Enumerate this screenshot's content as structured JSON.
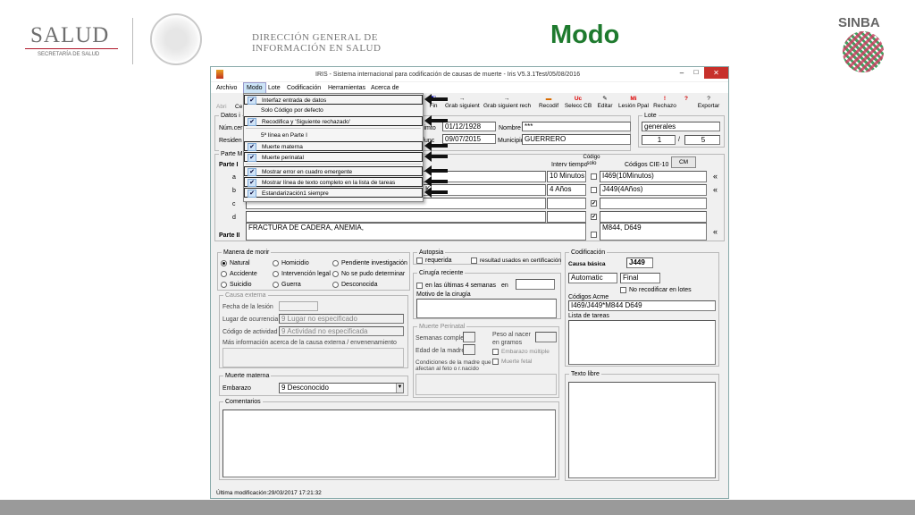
{
  "slide": {
    "title": "Modo",
    "header": {
      "salud": "SALUD",
      "secretaria": "SECRETARÍA DE SALUD",
      "direccion_l1": "DIRECCIÓN GENERAL DE",
      "direccion_l2": "INFORMACIÓN EN SALUD",
      "sinba": "SINBA"
    }
  },
  "window": {
    "title": "IRIS - Sistema internacional para codificación de causas de muerte - Iris V5.3.1Test/05/08/2016",
    "controls": [
      "–",
      "□",
      "✕"
    ]
  },
  "menubar": [
    "Archivo",
    "Modo",
    "Lote",
    "Codificación",
    "Herramientas",
    "Acerca de"
  ],
  "modo_menu": [
    {
      "label": "Interfaz entrada de datos",
      "checked": true,
      "boxed": true
    },
    {
      "label": "Solo Código por defecto",
      "checked": false,
      "boxed": false
    },
    {
      "label": "Recodifica y 'Siguiente rechazado'",
      "checked": true,
      "boxed": true
    },
    {
      "label": "5ª línea  en Parte I",
      "checked": false,
      "boxed": false
    },
    {
      "label": "Muerte materna",
      "checked": true,
      "boxed": true
    },
    {
      "label": "Muerte perinatal",
      "checked": true,
      "boxed": true
    },
    {
      "label": "Mostrar error en cuadro emergente",
      "checked": true,
      "boxed": true
    },
    {
      "label": "Mostrar línea de texto completo en la lista de tareas",
      "checked": true,
      "boxed": true
    },
    {
      "label": "Estandarización1 siempre",
      "checked": true,
      "boxed": true
    }
  ],
  "check_mark": "✔",
  "toolbar": {
    "left_labels": [
      "Abri",
      "Ce"
    ],
    "buttons": [
      "Fin",
      "Grab siguient",
      "Grab siguient rech",
      "Recodif",
      "Selecc CB",
      "Editar",
      "Lesión Ppal",
      "Rechazo",
      "Exportar"
    ],
    "icons": [
      "→",
      "→",
      "⇥",
      "▬",
      "Uc",
      "✎",
      "Mi",
      "!",
      "?"
    ],
    "help_icon": "?"
  },
  "datos": {
    "group": "Datos i",
    "num_label": "Núm.cer",
    "resid_label": "Residen",
    "fecha1": "01/12/1928",
    "fecha2": "09/07/2015",
    "nombre_label": "Nombre",
    "nombre": "***",
    "municipio_label": "Municipio",
    "municipio": "GUERRERO",
    "fecha1_label": "cimto",
    "fecha2_label": "func"
  },
  "lote": {
    "label": "Lote",
    "nombre": "generales",
    "n": "1",
    "sep": "/",
    "total": "5"
  },
  "parte": {
    "group": "Parte M",
    "parte1": "Parte I",
    "interv_label": "Interv tiempo",
    "codigo_solo": "Código solo",
    "codigos_cie": "Códigos CIE-10",
    "cm_button": "CM",
    "rows": [
      "a",
      "b",
      "c",
      "d"
    ],
    "intervals": [
      "10 Minutos",
      "4 Años",
      "",
      ""
    ],
    "codes": [
      "I469(10Minutos)",
      "J449(4Años)",
      "",
      ""
    ],
    "frag_b": "K",
    "parte2_label": "Parte II",
    "parte2_text": "FRACTURA DE CADERA,  ANEMIA,",
    "parte2_code": "M844, D649",
    "arrows": "«"
  },
  "manera": {
    "group": "Manera de morir",
    "options": [
      "Natural",
      "Accidente",
      "Suicidio",
      "Homicidio",
      "Intervención legal",
      "Guerra",
      "Pendiente investigación",
      "No se pudo determinar",
      "Desconocida"
    ]
  },
  "causa_externa": {
    "group": "Causa externa",
    "fecha_label": "Fecha de la lesión",
    "lugar_label": "Lugar de ocurrencia",
    "lugar": "9 Lugar no especificado",
    "actividad_label": "Código de actividad",
    "actividad": "9 Actividad no especificada",
    "mas_info": "Más información acerca de la causa externa / envenenamiento"
  },
  "muerte_materna": {
    "group": "Muerte materna",
    "embarazo_label": "Embarazo",
    "embarazo": "9 Desconocido"
  },
  "comentarios": {
    "group": "Comentarios"
  },
  "autopsia": {
    "group": "Autopsia",
    "requerida": "requerida",
    "resultados": "resultad usados en certificación"
  },
  "cirugia": {
    "group": "Cirugía reciente",
    "ultimas": "en las últimas 4 semanas",
    "en": "en",
    "motivo": "Motivo de la cirugía"
  },
  "perinatal": {
    "group": "Muerte Perinatal",
    "semanas": "Semanas complet",
    "edad_madre": "Edad de la madre",
    "peso": "Peso al nacer en gramos",
    "multiple": "Embarazo múltiple",
    "fetal": "Muerte fetal",
    "condiciones": "Condiciones de la madre que afectan al feto o r.nacido"
  },
  "codificacion": {
    "group": "Codificación",
    "causa_label": "Causa básica",
    "causa": "J449",
    "modo": "Automatic",
    "estado": "Final",
    "no_recod": "No recodificar en lotes",
    "acme_label": "Códigos Acme",
    "acme": "I469/J449*M844 D649",
    "tareas": "Lista de tareas"
  },
  "texto_libre": {
    "group": "Texto libre"
  },
  "status": "Última modificación:29/03/2017 17:21:32"
}
